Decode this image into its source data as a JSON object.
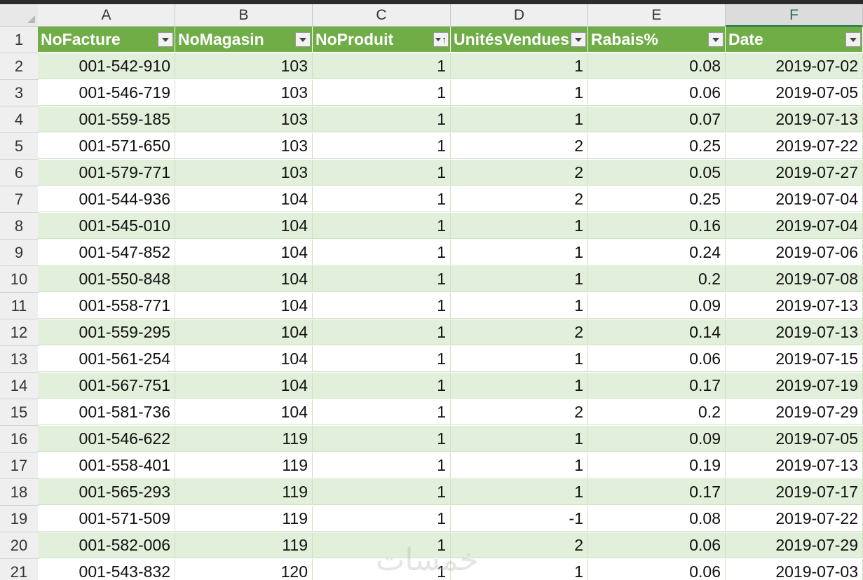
{
  "columns": [
    {
      "letter": "A",
      "selected": false
    },
    {
      "letter": "B",
      "selected": false
    },
    {
      "letter": "C",
      "selected": false
    },
    {
      "letter": "D",
      "selected": false
    },
    {
      "letter": "E",
      "selected": false
    },
    {
      "letter": "F",
      "selected": true
    }
  ],
  "table": {
    "header_row_number": "1",
    "headers": [
      {
        "label": "NoFacture",
        "filter": "dropdown"
      },
      {
        "label": "NoMagasin",
        "filter": "dropdown"
      },
      {
        "label": "NoProduit",
        "filter": "sorted-ascending"
      },
      {
        "label": "UnitésVendues",
        "filter": "dropdown"
      },
      {
        "label": "Rabais%",
        "filter": "dropdown"
      },
      {
        "label": "Date",
        "filter": "dropdown"
      }
    ],
    "rows": [
      {
        "n": "2",
        "cells": [
          "001-542-910",
          "103",
          "1",
          "1",
          "0.08",
          "2019-07-02"
        ]
      },
      {
        "n": "3",
        "cells": [
          "001-546-719",
          "103",
          "1",
          "1",
          "0.06",
          "2019-07-05"
        ]
      },
      {
        "n": "4",
        "cells": [
          "001-559-185",
          "103",
          "1",
          "1",
          "0.07",
          "2019-07-13"
        ]
      },
      {
        "n": "5",
        "cells": [
          "001-571-650",
          "103",
          "1",
          "2",
          "0.25",
          "2019-07-22"
        ]
      },
      {
        "n": "6",
        "cells": [
          "001-579-771",
          "103",
          "1",
          "2",
          "0.05",
          "2019-07-27"
        ]
      },
      {
        "n": "7",
        "cells": [
          "001-544-936",
          "104",
          "1",
          "2",
          "0.25",
          "2019-07-04"
        ]
      },
      {
        "n": "8",
        "cells": [
          "001-545-010",
          "104",
          "1",
          "1",
          "0.16",
          "2019-07-04"
        ]
      },
      {
        "n": "9",
        "cells": [
          "001-547-852",
          "104",
          "1",
          "1",
          "0.24",
          "2019-07-06"
        ]
      },
      {
        "n": "10",
        "cells": [
          "001-550-848",
          "104",
          "1",
          "1",
          "0.2",
          "2019-07-08"
        ]
      },
      {
        "n": "11",
        "cells": [
          "001-558-771",
          "104",
          "1",
          "1",
          "0.09",
          "2019-07-13"
        ]
      },
      {
        "n": "12",
        "cells": [
          "001-559-295",
          "104",
          "1",
          "2",
          "0.14",
          "2019-07-13"
        ]
      },
      {
        "n": "13",
        "cells": [
          "001-561-254",
          "104",
          "1",
          "1",
          "0.06",
          "2019-07-15"
        ]
      },
      {
        "n": "14",
        "cells": [
          "001-567-751",
          "104",
          "1",
          "1",
          "0.17",
          "2019-07-19"
        ]
      },
      {
        "n": "15",
        "cells": [
          "001-581-736",
          "104",
          "1",
          "2",
          "0.2",
          "2019-07-29"
        ]
      },
      {
        "n": "16",
        "cells": [
          "001-546-622",
          "119",
          "1",
          "1",
          "0.09",
          "2019-07-05"
        ]
      },
      {
        "n": "17",
        "cells": [
          "001-558-401",
          "119",
          "1",
          "1",
          "0.19",
          "2019-07-13"
        ]
      },
      {
        "n": "18",
        "cells": [
          "001-565-293",
          "119",
          "1",
          "1",
          "0.17",
          "2019-07-17"
        ]
      },
      {
        "n": "19",
        "cells": [
          "001-571-509",
          "119",
          "1",
          "-1",
          "0.08",
          "2019-07-22"
        ]
      },
      {
        "n": "20",
        "cells": [
          "001-582-006",
          "119",
          "1",
          "2",
          "0.06",
          "2019-07-29"
        ]
      },
      {
        "n": "21",
        "cells": [
          "001-543-832",
          "120",
          "1",
          "1",
          "0.06",
          "2019-07-03"
        ]
      }
    ]
  },
  "watermark": "خمسات",
  "colors": {
    "header_fill": "#70ad47",
    "band_fill": "#e2efda",
    "selected_column_accent": "#217346"
  }
}
